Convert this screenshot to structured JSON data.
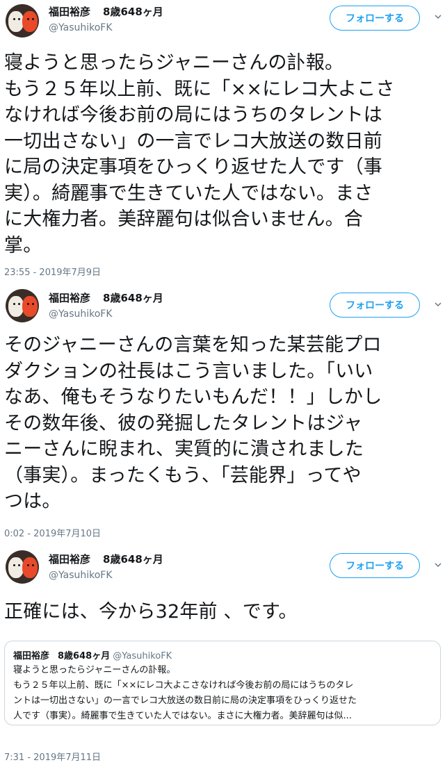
{
  "tweets": [
    {
      "name": "福田裕彦",
      "age": "8歳648ヶ月",
      "handle": "@YasuhikoFK",
      "follow_label": "フォローする",
      "body": "寝ようと思ったらジャニーさんの訃報。\nもう２５年以上前、既に「××にレコ大よこさ\nなければ今後お前の局にはうちのタレントは\n一切出さない」の一言でレコ大放送の数日前\nに局の決定事項をひっくり返せた人です（事\n実）。綺麗事で生きていた人ではない。まさ\nに大権力者。美辞麗句は似合いません。合\n掌。",
      "timestamp": "23:55 - 2019年7月9日"
    },
    {
      "name": "福田裕彦",
      "age": "8歳648ヶ月",
      "handle": "@YasuhikoFK",
      "follow_label": "フォローする",
      "body": "そのジャニーさんの言葉を知った某芸能プロ\nダクションの社長はこう言いました。「いい\nなあ、俺もそうなりたいもんだ！！」しかし\nその数年後、彼の発掘したタレントはジャ\nニーさんに睨まれ、実質的に潰されました\n（事実）。まったくもう、「芸能界」ってや\nつは。",
      "timestamp": "0:02 - 2019年7月10日"
    },
    {
      "name": "福田裕彦",
      "age": "8歳648ヶ月",
      "handle": "@YasuhikoFK",
      "follow_label": "フォローする",
      "body": "正確には、今から32年前 、です。",
      "timestamp": "7:31 - 2019年7月11日",
      "quote": {
        "name": "福田裕彦",
        "age": "8歳648ヶ月",
        "handle": "@YasuhikoFK",
        "body": "寝ようと思ったらジャニーさんの訃報。\nもう２５年以上前、既に「××にレコ大よこさなければ今後お前の局にはうちのタレ\nントは一切出さない」の一言でレコ大放送の数日前に局の決定事項をひっくり返せた\n人です（事実）。綺麗事で生きていた人ではない。まさに大権力者。美辞麗句は似..."
      }
    }
  ],
  "colors": {
    "accent": "#1da1f2",
    "muted": "#657786",
    "border": "#ccd6dd",
    "text": "#14171a"
  },
  "icons": {
    "avatar": "avatar-image",
    "menu": "chevron-down-icon"
  }
}
